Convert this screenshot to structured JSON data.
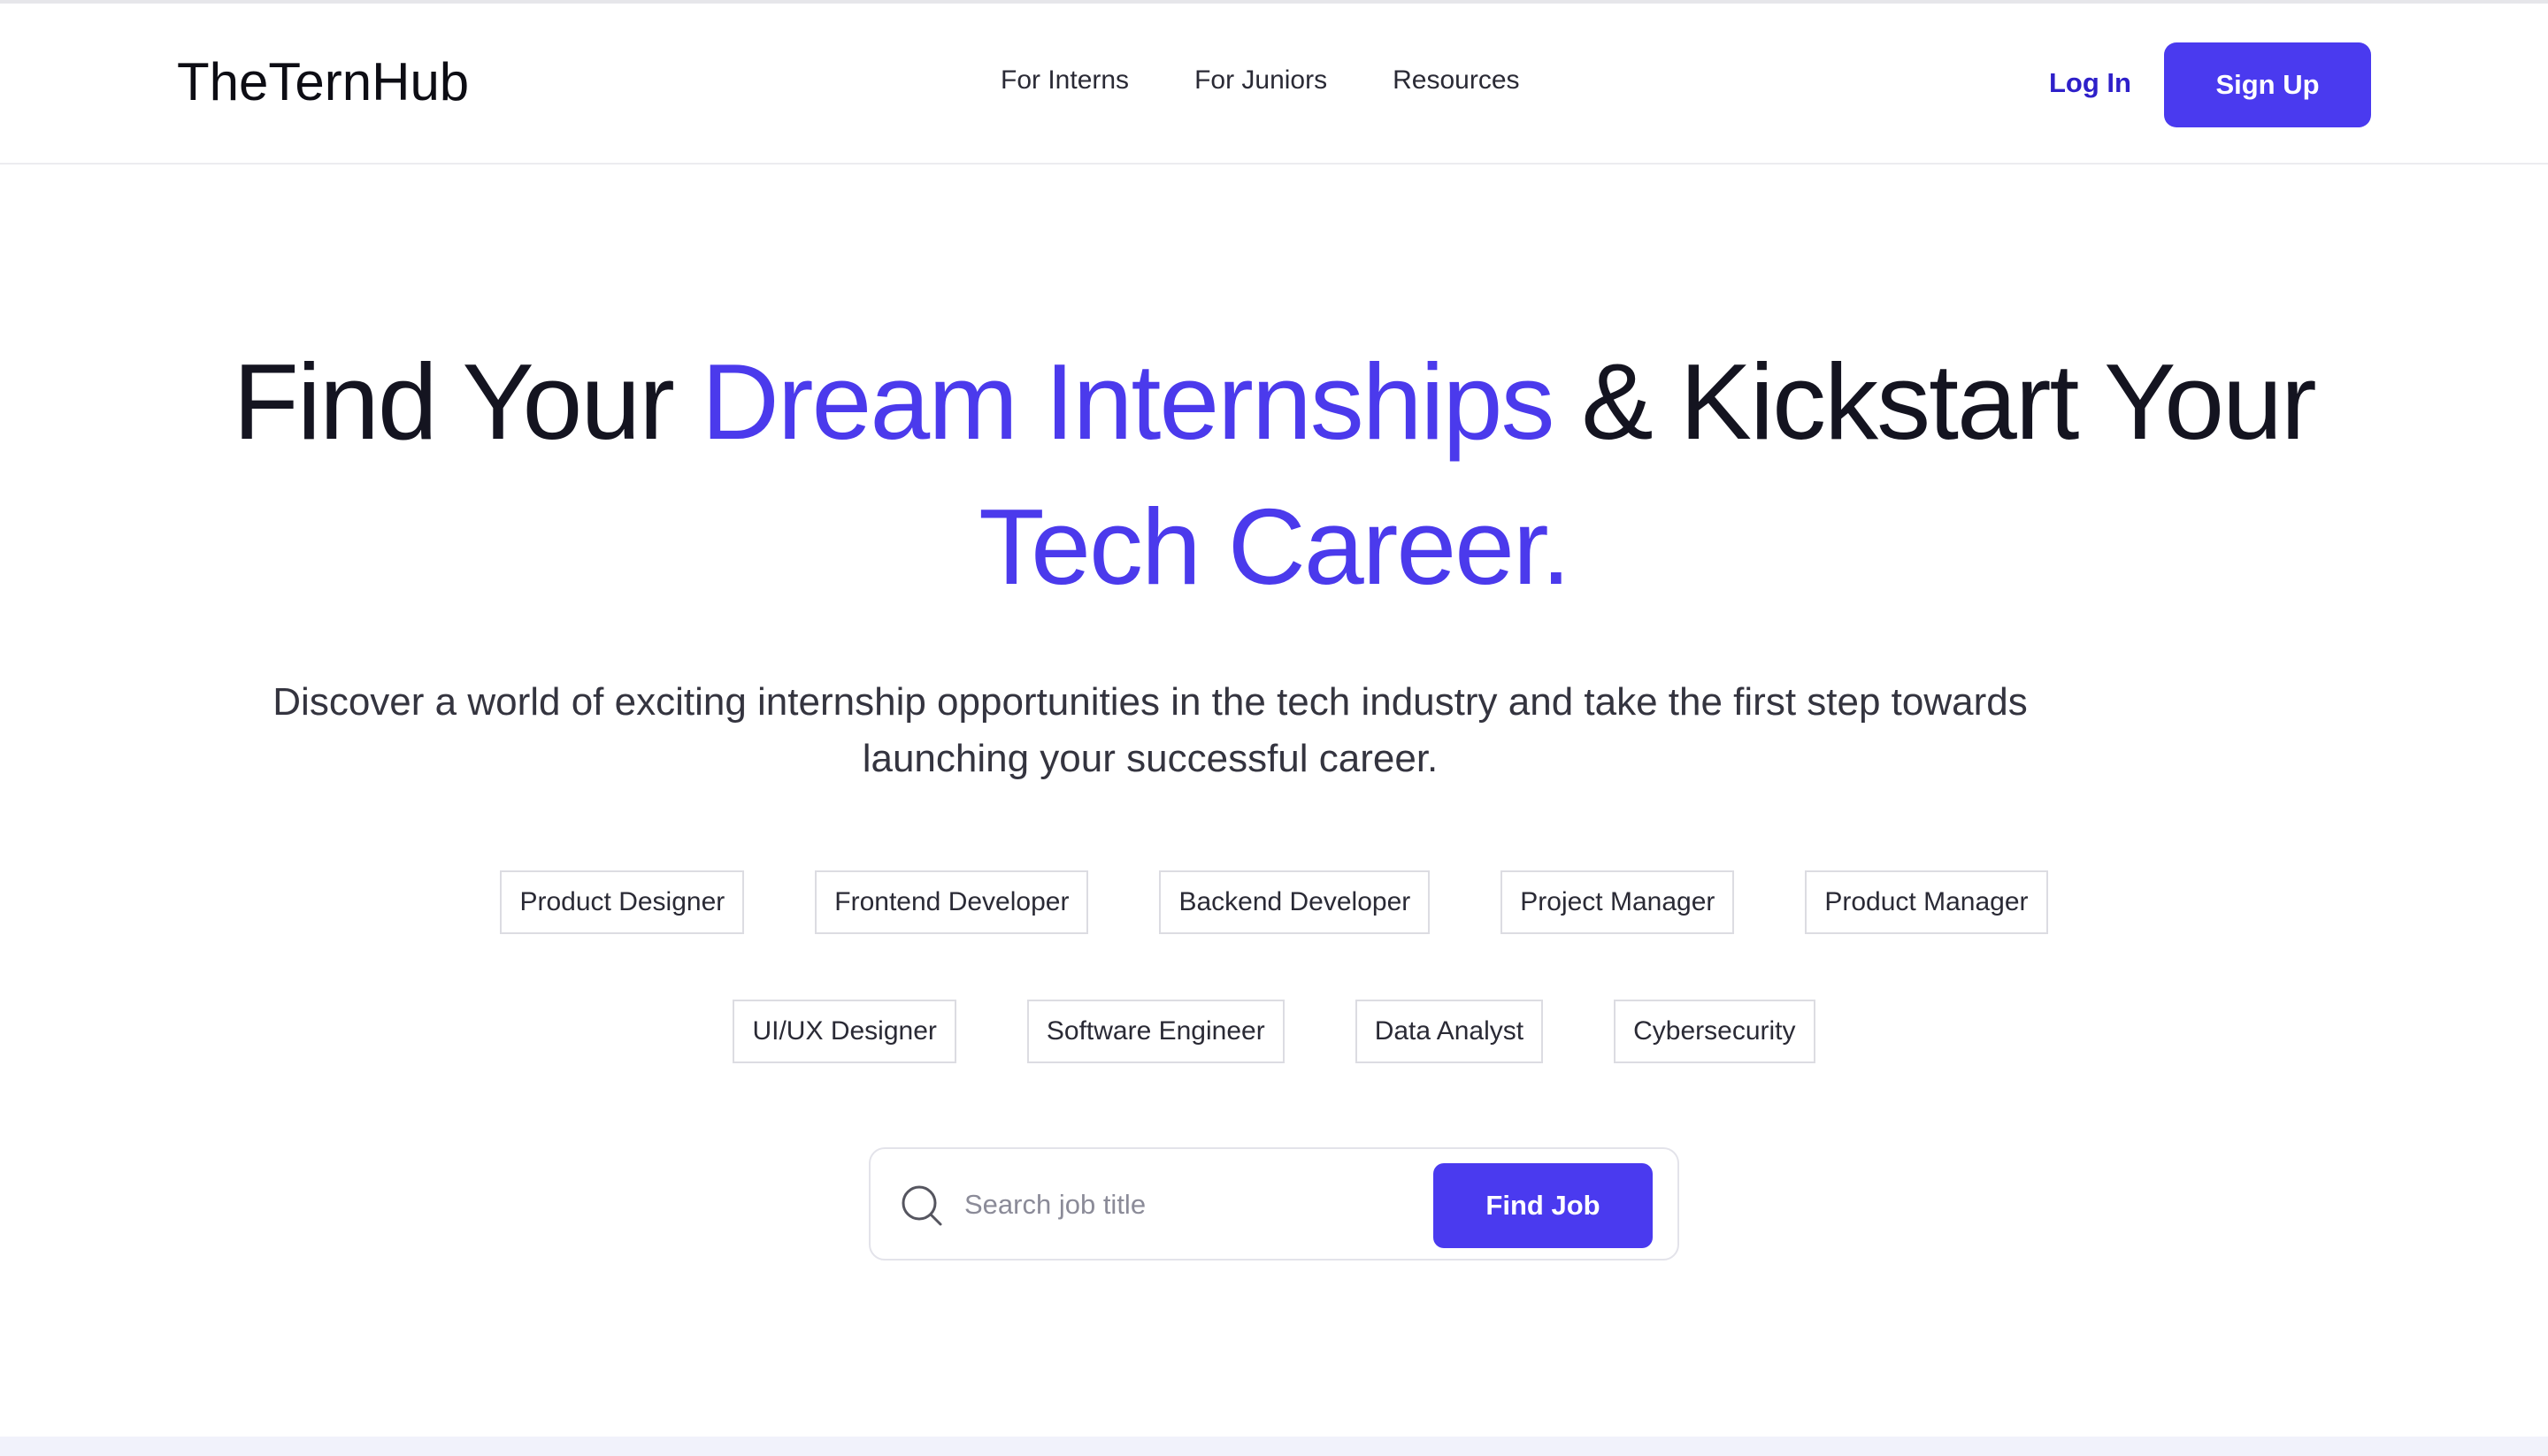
{
  "header": {
    "logo": "TheTernHub",
    "nav": [
      {
        "label": "For Interns"
      },
      {
        "label": "For Juniors"
      },
      {
        "label": "Resources"
      }
    ],
    "login_label": "Log In",
    "signup_label": "Sign Up"
  },
  "hero": {
    "title_part1": "Find Your ",
    "title_accent1": "Dream Internships",
    "title_part2": " & Kickstart Your",
    "title_accent2": "Tech Career.",
    "subtitle": "Discover a world of exciting internship opportunities in the tech industry and take the first step towards launching your successful career."
  },
  "categories": {
    "row1": [
      "Product Designer",
      "Frontend Developer",
      "Backend Developer",
      "Project Manager",
      "Product Manager"
    ],
    "row2": [
      "UI/UX Designer",
      "Software Engineer",
      "Data Analyst",
      "Cybersecurity"
    ]
  },
  "search": {
    "icon": "search-icon",
    "placeholder": "Search job title",
    "value": "",
    "button_label": "Find Job"
  },
  "colors": {
    "accent": "#4b3aec",
    "button": "#4a3aef",
    "login": "#2e20c9",
    "heading": "#141420"
  }
}
